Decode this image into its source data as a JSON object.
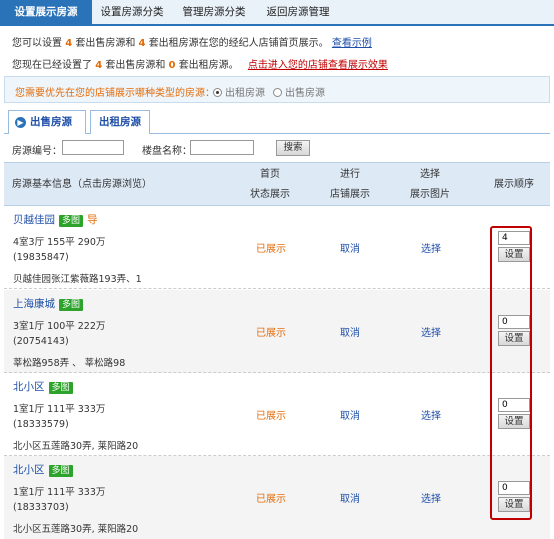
{
  "topnav": {
    "tabs": [
      "设置展示房源",
      "设置房源分类",
      "管理房源分类",
      "返回房源管理"
    ]
  },
  "info1": {
    "text_a": "您可以设置",
    "sale_count": "4",
    "text_b": "套出售房源和",
    "rent_count": "4",
    "text_c": "套出租房源在您的经纪人店铺首页展示。",
    "example_link": "查看示例"
  },
  "info2": {
    "text_a": "您现在已经设置了",
    "sale_count": "4",
    "text_b": "套出售房源和",
    "rent_count": "0",
    "text_c": "套出租房源。",
    "store_link": "点击进入您的店铺查看展示效果"
  },
  "preference": {
    "question": "您需要优先在您的店铺展示哪种类型的房源：",
    "options": [
      "出租房源",
      "出售房源"
    ]
  },
  "subtabs": [
    "出售房源",
    "出租房源"
  ],
  "search": {
    "id_label": "房源编号：",
    "name_label": "楼盘名称：",
    "button": "搜索"
  },
  "table": {
    "col_info": "房源基本信息（点击房源浏览）",
    "col_home_1": "首页",
    "col_home_2": "状态展示",
    "col_store_1": "进行",
    "col_store_2": "店铺展示",
    "col_img_1": "选择",
    "col_img_2": "展示图片",
    "col_order": "展示顺序"
  },
  "rows": [
    {
      "name": "贝越佳园",
      "badge": "多图",
      "hot": "导",
      "line1": "4室3厅  155平  290万",
      "line2": "(19835847)",
      "line3": "贝越佳园张江紫薇路193弄、1",
      "status": "已展示",
      "cancel": "取消",
      "choose": "选择",
      "order": "4",
      "set": "设置"
    },
    {
      "name": "上海康城",
      "badge": "多图",
      "hot": "",
      "line1": "3室1厅  100平  222万",
      "line2": "(20754143)",
      "line3": "莘松路958弄  、 莘松路98",
      "status": "已展示",
      "cancel": "取消",
      "choose": "选择",
      "order": "0",
      "set": "设置"
    },
    {
      "name": "北小区",
      "badge": "多图",
      "hot": "",
      "line1": "1室1厅  111平  333万",
      "line2": "(18333579)",
      "line3": "北小区五莲路30弄, 莱阳路20",
      "status": "已展示",
      "cancel": "取消",
      "choose": "选择",
      "order": "0",
      "set": "设置"
    },
    {
      "name": "北小区",
      "badge": "多图",
      "hot": "",
      "line1": "1室1厅  111平  333万",
      "line2": "(18333703)",
      "line3": "北小区五莲路30弄, 莱阳路20",
      "status": "已展示",
      "cancel": "取消",
      "choose": "选择",
      "order": "0",
      "set": "设置"
    }
  ]
}
